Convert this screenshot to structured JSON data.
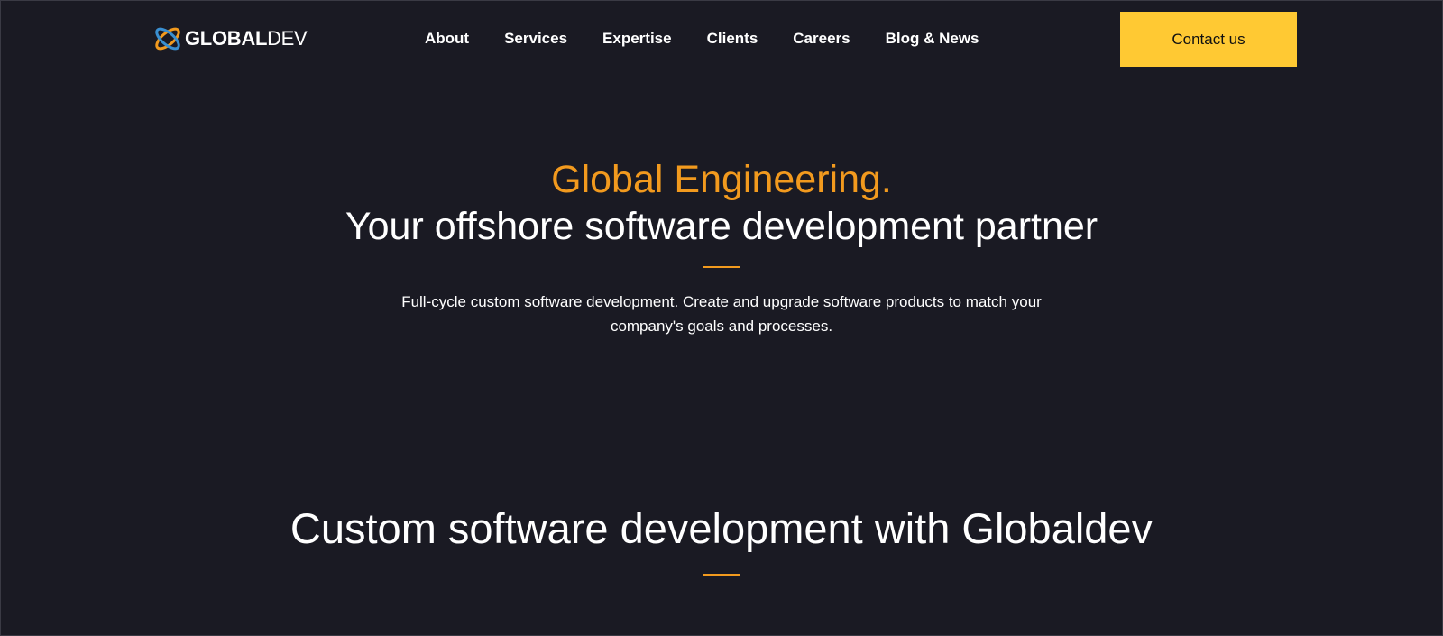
{
  "header": {
    "logo": {
      "strong": "GLOBAL",
      "light": "DEV",
      "icon": "globaldev-orbit-logo-icon"
    },
    "nav": [
      {
        "label": "About"
      },
      {
        "label": "Services"
      },
      {
        "label": "Expertise"
      },
      {
        "label": "Clients"
      },
      {
        "label": "Careers"
      },
      {
        "label": "Blog & News"
      }
    ],
    "cta_label": "Contact us"
  },
  "hero": {
    "accent": "Global Engineering.",
    "title": "Your offshore software development partner",
    "subtitle": "Full-cycle custom software development. Create and upgrade software products to match your company's goals and processes."
  },
  "section": {
    "title": "Custom software development with Globaldev"
  },
  "colors": {
    "background": "#1a1a23",
    "accent": "#f29a1e",
    "cta": "#ffc933",
    "text": "#ffffff"
  }
}
